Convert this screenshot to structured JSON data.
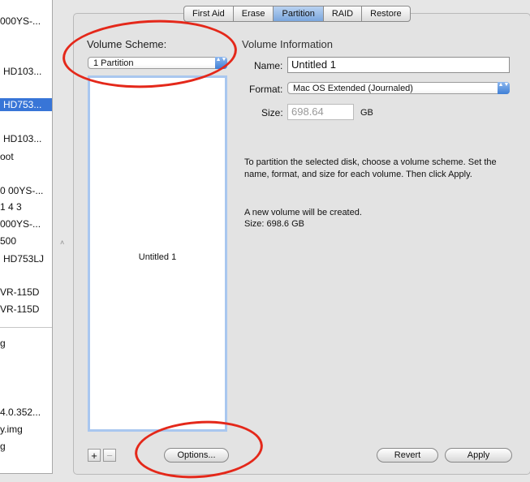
{
  "sidebar": {
    "items": [
      {
        "label": "000YS-...",
        "selected": false
      },
      {
        "label": "HD103...",
        "selected": false
      },
      {
        "label": "HD753...",
        "selected": true
      },
      {
        "label": "HD103...",
        "selected": false
      },
      {
        "label": "oot",
        "selected": false
      },
      {
        "label": "0 00YS-...",
        "selected": false
      },
      {
        "label": "1 4 3",
        "selected": false
      },
      {
        "label": "000YS-...",
        "selected": false
      },
      {
        "label": "500",
        "selected": false
      },
      {
        "label": "HD753LJ",
        "selected": false
      },
      {
        "label": "VR-115D",
        "selected": false
      },
      {
        "label": "VR-115D",
        "selected": false
      },
      {
        "label": "g",
        "selected": false
      },
      {
        "label": "4.0.352...",
        "selected": false
      },
      {
        "label": "y.img",
        "selected": false
      },
      {
        "label": "g",
        "selected": false
      }
    ]
  },
  "tabs": [
    "First Aid",
    "Erase",
    "Partition",
    "RAID",
    "Restore"
  ],
  "active_tab": "Partition",
  "volume_scheme": {
    "heading": "Volume Scheme:",
    "selected": "1 Partition",
    "partition_label": "Untitled 1"
  },
  "volume_info": {
    "heading": "Volume Information",
    "name_label": "Name:",
    "name_value": "Untitled 1",
    "format_label": "Format:",
    "format_value": "Mac OS Extended (Journaled)",
    "size_label": "Size:",
    "size_value": "698.64",
    "size_unit": "GB",
    "instructions": "To partition the selected disk, choose a volume scheme. Set the name, format, and size for each volume. Then click Apply.",
    "status_line1": "A new volume will be created.",
    "status_line2": "Size: 698.6 GB"
  },
  "buttons": {
    "add": "+",
    "remove": "−",
    "options": "Options...",
    "revert": "Revert",
    "apply": "Apply"
  },
  "splitter_glyph": "˄",
  "stepper_glyph": "▲▼",
  "colors": {
    "selection": "#3875d7",
    "annotation": "#e4281a",
    "active_tab": "#8fb4e6"
  }
}
